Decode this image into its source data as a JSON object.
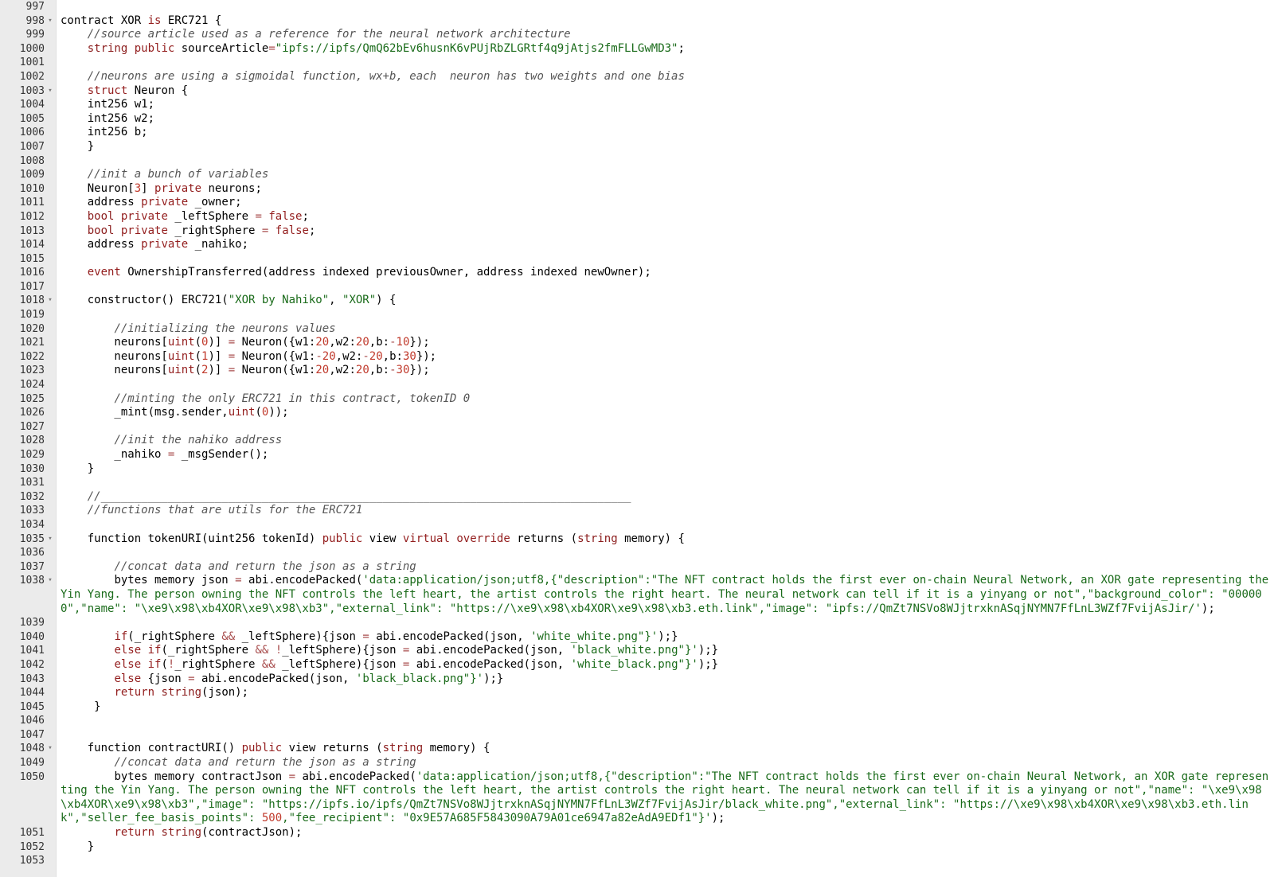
{
  "editor": {
    "lines": [
      {
        "n": "997",
        "fold": false,
        "t": []
      },
      {
        "n": "998",
        "fold": true,
        "t": [
          [
            "p",
            "contract XOR "
          ],
          [
            "k",
            "is"
          ],
          [
            "p",
            " ERC721 {"
          ]
        ]
      },
      {
        "n": "999",
        "fold": false,
        "t": [
          [
            "p",
            "    "
          ],
          [
            "c",
            "//source article used as a reference for the neural network architecture"
          ]
        ]
      },
      {
        "n": "1000",
        "fold": false,
        "t": [
          [
            "p",
            "    "
          ],
          [
            "y",
            "string"
          ],
          [
            "p",
            " "
          ],
          [
            "k",
            "public"
          ],
          [
            "p",
            " sourceArticle"
          ],
          [
            "o",
            "="
          ],
          [
            "s",
            "\"ipfs://ipfs/QmQ62bEv6husnK6vPUjRbZLGRtf4q9jAtjs2fmFLLGwMD3\""
          ],
          [
            "p",
            ";"
          ]
        ]
      },
      {
        "n": "1001",
        "fold": false,
        "t": []
      },
      {
        "n": "1002",
        "fold": false,
        "t": [
          [
            "p",
            "    "
          ],
          [
            "c",
            "//neurons are using a sigmoidal function, wx+b, each  neuron has two weights and one bias"
          ]
        ]
      },
      {
        "n": "1003",
        "fold": true,
        "t": [
          [
            "p",
            "    "
          ],
          [
            "k",
            "struct"
          ],
          [
            "p",
            " Neuron {"
          ]
        ]
      },
      {
        "n": "1004",
        "fold": false,
        "t": [
          [
            "p",
            "    int256 w1;"
          ]
        ]
      },
      {
        "n": "1005",
        "fold": false,
        "t": [
          [
            "p",
            "    int256 w2;"
          ]
        ]
      },
      {
        "n": "1006",
        "fold": false,
        "t": [
          [
            "p",
            "    int256 b;"
          ]
        ]
      },
      {
        "n": "1007",
        "fold": false,
        "t": [
          [
            "p",
            "    }"
          ]
        ]
      },
      {
        "n": "1008",
        "fold": false,
        "t": []
      },
      {
        "n": "1009",
        "fold": false,
        "t": [
          [
            "p",
            "    "
          ],
          [
            "c",
            "//init a bunch of variables"
          ]
        ]
      },
      {
        "n": "1010",
        "fold": false,
        "t": [
          [
            "p",
            "    Neuron["
          ],
          [
            "d",
            "3"
          ],
          [
            "p",
            "] "
          ],
          [
            "k",
            "private"
          ],
          [
            "p",
            " neurons;"
          ]
        ]
      },
      {
        "n": "1011",
        "fold": false,
        "t": [
          [
            "p",
            "    address "
          ],
          [
            "k",
            "private"
          ],
          [
            "p",
            " _owner;"
          ]
        ]
      },
      {
        "n": "1012",
        "fold": false,
        "t": [
          [
            "p",
            "    "
          ],
          [
            "y",
            "bool"
          ],
          [
            "p",
            " "
          ],
          [
            "k",
            "private"
          ],
          [
            "p",
            " _leftSphere "
          ],
          [
            "o",
            "="
          ],
          [
            "p",
            " "
          ],
          [
            "k",
            "false"
          ],
          [
            "p",
            ";"
          ]
        ]
      },
      {
        "n": "1013",
        "fold": false,
        "t": [
          [
            "p",
            "    "
          ],
          [
            "y",
            "bool"
          ],
          [
            "p",
            " "
          ],
          [
            "k",
            "private"
          ],
          [
            "p",
            " _rightSphere "
          ],
          [
            "o",
            "="
          ],
          [
            "p",
            " "
          ],
          [
            "k",
            "false"
          ],
          [
            "p",
            ";"
          ]
        ]
      },
      {
        "n": "1014",
        "fold": false,
        "t": [
          [
            "p",
            "    address "
          ],
          [
            "k",
            "private"
          ],
          [
            "p",
            " _nahiko;"
          ]
        ]
      },
      {
        "n": "1015",
        "fold": false,
        "t": []
      },
      {
        "n": "1016",
        "fold": false,
        "t": [
          [
            "p",
            "    "
          ],
          [
            "k",
            "event"
          ],
          [
            "p",
            " OwnershipTransferred(address indexed previousOwner, address indexed newOwner);"
          ]
        ]
      },
      {
        "n": "1017",
        "fold": false,
        "t": []
      },
      {
        "n": "1018",
        "fold": true,
        "t": [
          [
            "p",
            "    constructor() ERC721("
          ],
          [
            "s",
            "\"XOR by Nahiko\""
          ],
          [
            "p",
            ", "
          ],
          [
            "s",
            "\"XOR\""
          ],
          [
            "p",
            ") {"
          ]
        ]
      },
      {
        "n": "1019",
        "fold": false,
        "t": []
      },
      {
        "n": "1020",
        "fold": false,
        "t": [
          [
            "p",
            "        "
          ],
          [
            "c",
            "//initializing the neurons values"
          ]
        ]
      },
      {
        "n": "1021",
        "fold": false,
        "t": [
          [
            "p",
            "        neurons["
          ],
          [
            "k",
            "uint"
          ],
          [
            "p",
            "("
          ],
          [
            "d",
            "0"
          ],
          [
            "p",
            ")] "
          ],
          [
            "o",
            "="
          ],
          [
            "p",
            " Neuron({w1:"
          ],
          [
            "d",
            "20"
          ],
          [
            "p",
            ",w2:"
          ],
          [
            "d",
            "20"
          ],
          [
            "p",
            ",b:"
          ],
          [
            "o",
            "-"
          ],
          [
            "d",
            "10"
          ],
          [
            "p",
            "});"
          ]
        ]
      },
      {
        "n": "1022",
        "fold": false,
        "t": [
          [
            "p",
            "        neurons["
          ],
          [
            "k",
            "uint"
          ],
          [
            "p",
            "("
          ],
          [
            "d",
            "1"
          ],
          [
            "p",
            ")] "
          ],
          [
            "o",
            "="
          ],
          [
            "p",
            " Neuron({w1:"
          ],
          [
            "o",
            "-"
          ],
          [
            "d",
            "20"
          ],
          [
            "p",
            ",w2:"
          ],
          [
            "o",
            "-"
          ],
          [
            "d",
            "20"
          ],
          [
            "p",
            ",b:"
          ],
          [
            "d",
            "30"
          ],
          [
            "p",
            "});"
          ]
        ]
      },
      {
        "n": "1023",
        "fold": false,
        "t": [
          [
            "p",
            "        neurons["
          ],
          [
            "k",
            "uint"
          ],
          [
            "p",
            "("
          ],
          [
            "d",
            "2"
          ],
          [
            "p",
            ")] "
          ],
          [
            "o",
            "="
          ],
          [
            "p",
            " Neuron({w1:"
          ],
          [
            "d",
            "20"
          ],
          [
            "p",
            ",w2:"
          ],
          [
            "d",
            "20"
          ],
          [
            "p",
            ",b:"
          ],
          [
            "o",
            "-"
          ],
          [
            "d",
            "30"
          ],
          [
            "p",
            "});"
          ]
        ]
      },
      {
        "n": "1024",
        "fold": false,
        "t": []
      },
      {
        "n": "1025",
        "fold": false,
        "t": [
          [
            "p",
            "        "
          ],
          [
            "c",
            "//minting the only ERC721 in this contract, tokenID 0"
          ]
        ]
      },
      {
        "n": "1026",
        "fold": false,
        "t": [
          [
            "p",
            "        _mint(msg.sender,"
          ],
          [
            "k",
            "uint"
          ],
          [
            "p",
            "("
          ],
          [
            "d",
            "0"
          ],
          [
            "p",
            "));"
          ]
        ]
      },
      {
        "n": "1027",
        "fold": false,
        "t": []
      },
      {
        "n": "1028",
        "fold": false,
        "t": [
          [
            "p",
            "        "
          ],
          [
            "c",
            "//init the nahiko address"
          ]
        ]
      },
      {
        "n": "1029",
        "fold": false,
        "t": [
          [
            "p",
            "        _nahiko "
          ],
          [
            "o",
            "="
          ],
          [
            "p",
            " _msgSender();"
          ]
        ]
      },
      {
        "n": "1030",
        "fold": false,
        "t": [
          [
            "p",
            "    }"
          ]
        ]
      },
      {
        "n": "1031",
        "fold": false,
        "t": []
      },
      {
        "n": "1032",
        "fold": false,
        "t": [
          [
            "p",
            "    "
          ],
          [
            "c",
            "//_______________________________________________________________________________"
          ]
        ]
      },
      {
        "n": "1033",
        "fold": false,
        "t": [
          [
            "p",
            "    "
          ],
          [
            "c",
            "//functions that are utils for the ERC721"
          ]
        ]
      },
      {
        "n": "1034",
        "fold": false,
        "t": []
      },
      {
        "n": "1035",
        "fold": true,
        "t": [
          [
            "p",
            "    function tokenURI(uint256 tokenId) "
          ],
          [
            "k",
            "public"
          ],
          [
            "p",
            " view "
          ],
          [
            "k",
            "virtual"
          ],
          [
            "p",
            " "
          ],
          [
            "k",
            "override"
          ],
          [
            "p",
            " returns ("
          ],
          [
            "y",
            "string"
          ],
          [
            "p",
            " memory) {"
          ]
        ]
      },
      {
        "n": "1036",
        "fold": false,
        "t": []
      },
      {
        "n": "1037",
        "fold": false,
        "t": [
          [
            "p",
            "        "
          ],
          [
            "c",
            "//concat data and return the json as a string"
          ]
        ]
      },
      {
        "n": "1038",
        "fold": true,
        "wrap": true,
        "t": [
          [
            "p",
            "        bytes memory json "
          ],
          [
            "o",
            "="
          ],
          [
            "p",
            " abi.encodePacked("
          ],
          [
            "s",
            "'data:application/json;utf8,{\"description\":\"The NFT contract holds the first ever on-chain Neural Network, an XOR gate representing the Yin Yang. The person owning the NFT controls the left heart, the artist controls the right heart. The neural network can tell if it is a yinyang or not\",\"background_color\": \"000000\",\"name\": \"\\xe9\\x98\\xb4XOR\\xe9\\x98\\xb3\",\"external_link\": \"https://\\xe9\\x98\\xb4XOR\\xe9\\x98\\xb3.eth.link\",\"image\": \"ipfs://QmZt7NSVo8WJjtrxknASqjNYMN7FfLnL3WZf7FvijAsJir/'"
          ],
          [
            "p",
            ");"
          ]
        ]
      },
      {
        "n": "1039",
        "fold": false,
        "t": []
      },
      {
        "n": "1040",
        "fold": false,
        "t": [
          [
            "p",
            "        "
          ],
          [
            "k",
            "if"
          ],
          [
            "p",
            "(_rightSphere "
          ],
          [
            "o",
            "&&"
          ],
          [
            "p",
            " _leftSphere){json "
          ],
          [
            "o",
            "="
          ],
          [
            "p",
            " abi.encodePacked(json, "
          ],
          [
            "s",
            "'white_white.png\"}'"
          ],
          [
            "p",
            ");}"
          ]
        ]
      },
      {
        "n": "1041",
        "fold": false,
        "t": [
          [
            "p",
            "        "
          ],
          [
            "k",
            "else if"
          ],
          [
            "p",
            "(_rightSphere "
          ],
          [
            "o",
            "&&"
          ],
          [
            "p",
            " "
          ],
          [
            "o",
            "!"
          ],
          [
            "p",
            "_leftSphere){json "
          ],
          [
            "o",
            "="
          ],
          [
            "p",
            " abi.encodePacked(json, "
          ],
          [
            "s",
            "'black_white.png\"}'"
          ],
          [
            "p",
            ");}"
          ]
        ]
      },
      {
        "n": "1042",
        "fold": false,
        "t": [
          [
            "p",
            "        "
          ],
          [
            "k",
            "else if"
          ],
          [
            "p",
            "("
          ],
          [
            "o",
            "!"
          ],
          [
            "p",
            "_rightSphere "
          ],
          [
            "o",
            "&&"
          ],
          [
            "p",
            " _leftSphere){json "
          ],
          [
            "o",
            "="
          ],
          [
            "p",
            " abi.encodePacked(json, "
          ],
          [
            "s",
            "'white_black.png\"}'"
          ],
          [
            "p",
            ");}"
          ]
        ]
      },
      {
        "n": "1043",
        "fold": false,
        "t": [
          [
            "p",
            "        "
          ],
          [
            "k",
            "else"
          ],
          [
            "p",
            " {json "
          ],
          [
            "o",
            "="
          ],
          [
            "p",
            " abi.encodePacked(json, "
          ],
          [
            "s",
            "'black_black.png\"}'"
          ],
          [
            "p",
            ");}"
          ]
        ]
      },
      {
        "n": "1044",
        "fold": false,
        "t": [
          [
            "p",
            "        "
          ],
          [
            "k",
            "return"
          ],
          [
            "p",
            " "
          ],
          [
            "y",
            "string"
          ],
          [
            "p",
            "(json);"
          ]
        ]
      },
      {
        "n": "1045",
        "fold": false,
        "t": [
          [
            "p",
            "     }"
          ]
        ]
      },
      {
        "n": "1046",
        "fold": false,
        "t": []
      },
      {
        "n": "1047",
        "fold": false,
        "t": []
      },
      {
        "n": "1048",
        "fold": true,
        "t": [
          [
            "p",
            "    function contractURI() "
          ],
          [
            "k",
            "public"
          ],
          [
            "p",
            " view returns ("
          ],
          [
            "y",
            "string"
          ],
          [
            "p",
            " memory) {"
          ]
        ]
      },
      {
        "n": "1049",
        "fold": false,
        "t": [
          [
            "p",
            "        "
          ],
          [
            "c",
            "//concat data and return the json as a string"
          ]
        ]
      },
      {
        "n": "1050",
        "fold": false,
        "wrap": true,
        "t": [
          [
            "p",
            "        bytes memory contractJson "
          ],
          [
            "o",
            "="
          ],
          [
            "p",
            " abi.encodePacked("
          ],
          [
            "s",
            "'data:application/json;utf8,{\"description\":\"The NFT contract holds the first ever on-chain Neural Network, an XOR gate representing the Yin Yang. The person owning the NFT controls the left heart, the artist controls the right heart. The neural network can tell if it is a yinyang or not\",\"name\": \"\\xe9\\x98\\xb4XOR\\xe9\\x98\\xb3\",\"image\": \"https://ipfs.io/ipfs/QmZt7NSVo8WJjtrxknASqjNYMN7FfLnL3WZf7FvijAsJir/black_white.png\",\"external_link\": \"https://\\xe9\\x98\\xb4XOR\\xe9\\x98\\xb3.eth.link\",\"seller_fee_basis_points\": "
          ],
          [
            "d",
            "500"
          ],
          [
            "s",
            ",\"fee_recipient\": \"0x9E57A685F5843090A79A01ce6947a82eAdA9EDf1\"}'"
          ],
          [
            "p",
            ");"
          ]
        ]
      },
      {
        "n": "1051",
        "fold": false,
        "t": [
          [
            "p",
            "        "
          ],
          [
            "k",
            "return"
          ],
          [
            "p",
            " "
          ],
          [
            "y",
            "string"
          ],
          [
            "p",
            "(contractJson);"
          ]
        ]
      },
      {
        "n": "1052",
        "fold": false,
        "t": [
          [
            "p",
            "    }"
          ]
        ]
      },
      {
        "n": "1053",
        "fold": false,
        "t": []
      }
    ],
    "token_colors": {
      "p": "#000000",
      "k": "#931d1d",
      "y": "#8a1b1b",
      "s": "#1a6b1a",
      "d": "#c0392b",
      "c": "#555555",
      "o": "#a84d4d"
    },
    "fold_icon": "chevron-down-icon"
  }
}
